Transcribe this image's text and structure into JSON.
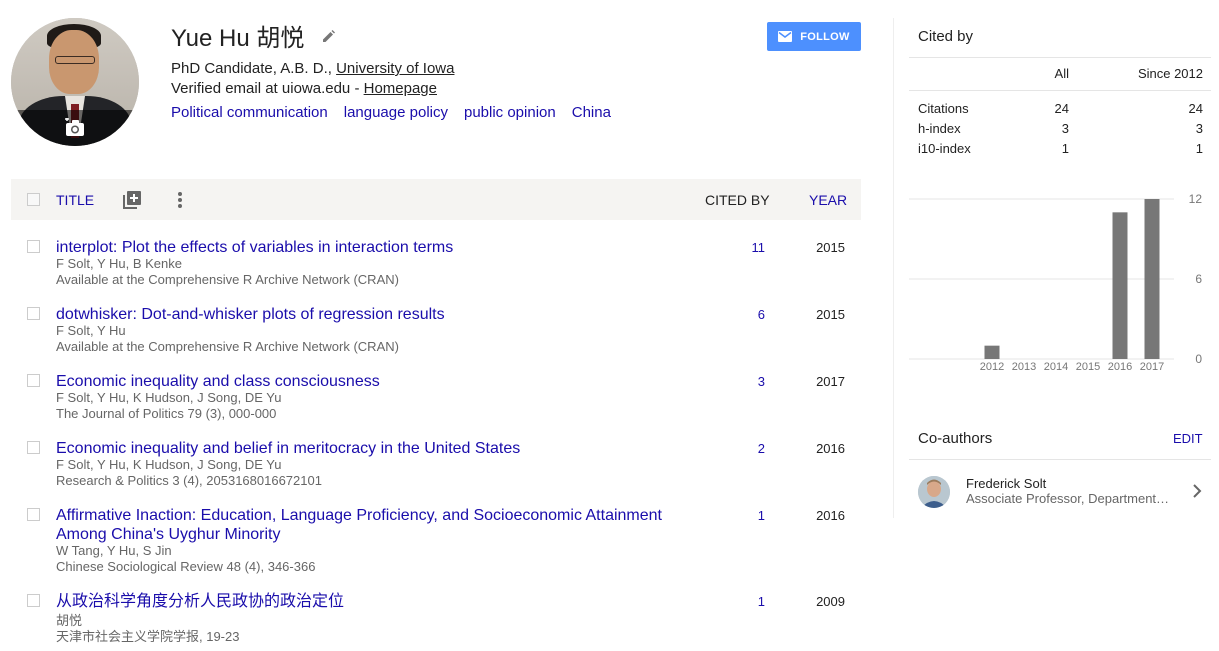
{
  "profile": {
    "name": "Yue Hu 胡悦",
    "affiliation_prefix": "PhD Candidate, A.B. D., ",
    "affiliation_link": "University of Iowa",
    "email_prefix": "Verified email at uiowa.edu - ",
    "homepage_link": "Homepage",
    "interests": [
      "Political communication",
      "language policy",
      "public opinion",
      "China"
    ],
    "follow_label": "FOLLOW"
  },
  "table": {
    "title_header": "TITLE",
    "cited_header": "CITED BY",
    "year_header": "YEAR",
    "rows": [
      {
        "title": "interplot: Plot the effects of variables in interaction terms",
        "authors": "F Solt, Y Hu, B Kenke",
        "venue": "Available at the Comprehensive R Archive Network (CRAN)",
        "cited": "11",
        "year": "2015"
      },
      {
        "title": "dotwhisker: Dot-and-whisker plots of regression results",
        "authors": "F Solt, Y Hu",
        "venue": "Available at the Comprehensive R Archive Network (CRAN)",
        "cited": "6",
        "year": "2015"
      },
      {
        "title": "Economic inequality and class consciousness",
        "authors": "F Solt, Y Hu, K Hudson, J Song, DE Yu",
        "venue": "The Journal of Politics 79 (3), 000-000",
        "cited": "3",
        "year": "2017"
      },
      {
        "title": "Economic inequality and belief in meritocracy in the United States",
        "authors": "F Solt, Y Hu, K Hudson, J Song, DE Yu",
        "venue": "Research & Politics 3 (4), 2053168016672101",
        "cited": "2",
        "year": "2016"
      },
      {
        "title": "Affirmative Inaction: Education, Language Proficiency, and Socioeconomic Attainment Among China's Uyghur Minority",
        "authors": "W Tang, Y Hu, S Jin",
        "venue": "Chinese Sociological Review 48 (4), 346-366",
        "cited": "1",
        "year": "2016"
      },
      {
        "title": "从政治科学角度分析人民政协的政治定位",
        "authors": "胡悦",
        "venue": "天津市社会主义学院学报, 19-23",
        "cited": "1",
        "year": "2009"
      }
    ]
  },
  "cited_by": {
    "title": "Cited by",
    "col_all": "All",
    "col_since": "Since 2012",
    "stats": [
      {
        "label": "Citations",
        "all": "24",
        "since": "24"
      },
      {
        "label": "h-index",
        "all": "3",
        "since": "3"
      },
      {
        "label": "i10-index",
        "all": "1",
        "since": "1"
      }
    ]
  },
  "chart_data": {
    "type": "bar",
    "categories": [
      "2012",
      "2013",
      "2014",
      "2015",
      "2016",
      "2017"
    ],
    "values": [
      1,
      0,
      0,
      0,
      11,
      12
    ],
    "ylim": [
      0,
      12
    ],
    "yticks": [
      "12",
      "6",
      "0"
    ],
    "grid": true,
    "bar_color": "#777777"
  },
  "coauthors": {
    "title": "Co-authors",
    "edit_label": "EDIT",
    "items": [
      {
        "name": "Frederick Solt",
        "affiliation": "Associate Professor, Department of Political Science, University of Iowa"
      }
    ]
  },
  "colors": {
    "link": "#1a0dab",
    "follow": "#4d90fe"
  }
}
